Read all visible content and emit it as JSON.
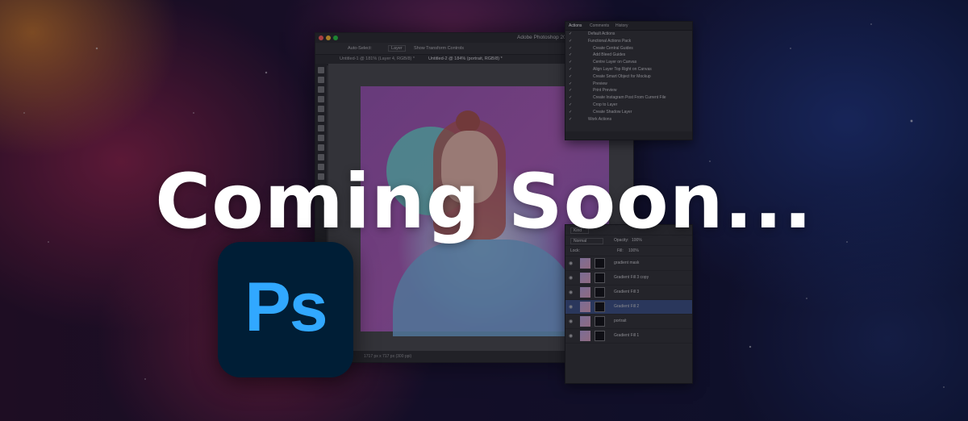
{
  "headline": "Coming Soon...",
  "logo": {
    "text": "Ps",
    "bg_color": "#001e36",
    "text_color": "#31a8ff"
  },
  "photoshop": {
    "title": "Adobe Photoshop 20",
    "options_bar": {
      "auto_select": "Auto-Select:",
      "layer_dropdown": "Layer",
      "show_transform": "Show Transform Controls"
    },
    "tabs": [
      "Untitled-1 @ 181% (Layer 4, RGB/8) *",
      "Untitled-2 @ 184% (portrait, RGB/8) *"
    ],
    "status": "1717 px x 717 px (300 ppi)"
  },
  "actions_panel": {
    "tabs": [
      "Actions",
      "Comments",
      "History"
    ],
    "items": [
      "Default Actions",
      "Functional Actions Pack",
      "Create Central Guides",
      "Add Bleed Guides",
      "Centre Layer on Canvas",
      "Align Layer Top Right on Canvas",
      "Create Smart Object for Mockup",
      "Preview",
      "Print Preview",
      "Create Instagram Post From Current File",
      "Crop to Layer",
      "Create Shadow Layer",
      "Work Actions"
    ]
  },
  "layers_panel": {
    "kind": "Kind",
    "blend_mode": "Normal",
    "opacity_label": "Opacity:",
    "opacity": "100%",
    "lock_label": "Lock:",
    "fill_label": "Fill:",
    "fill": "100%",
    "layers": [
      {
        "name": "gradient mask",
        "selected": false
      },
      {
        "name": "Gradient Fill 3 copy",
        "selected": false
      },
      {
        "name": "Gradient Fill 3",
        "selected": false
      },
      {
        "name": "Gradient Fill 2",
        "selected": true
      },
      {
        "name": "portrait",
        "selected": false
      },
      {
        "name": "Gradient Fill 1",
        "selected": false
      }
    ]
  }
}
